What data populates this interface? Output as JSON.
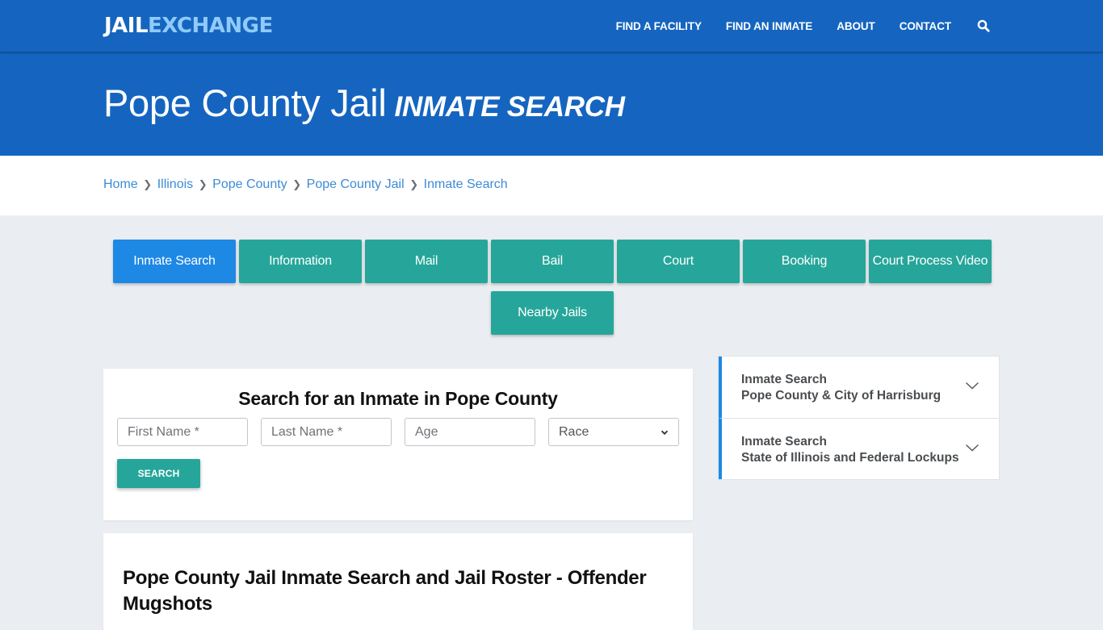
{
  "brand": {
    "logo_part1": "JAIL",
    "logo_part2": "EXCHANGE",
    "primary_color": "#1565c0",
    "accent_color": "#26a69a",
    "active_color": "#1e88e5"
  },
  "nav": {
    "items": [
      {
        "label": "FIND A FACILITY"
      },
      {
        "label": "FIND AN INMATE"
      },
      {
        "label": "ABOUT"
      },
      {
        "label": "CONTACT"
      }
    ],
    "search_icon": "search-icon"
  },
  "hero": {
    "title": "Pope County Jail",
    "subtitle": "INMATE SEARCH"
  },
  "breadcrumb": [
    {
      "label": "Home"
    },
    {
      "label": "Illinois"
    },
    {
      "label": "Pope County"
    },
    {
      "label": "Pope County Jail"
    },
    {
      "label": "Inmate Search"
    }
  ],
  "tabs": [
    {
      "label": "Inmate Search",
      "active": true
    },
    {
      "label": "Information",
      "active": false
    },
    {
      "label": "Mail",
      "active": false
    },
    {
      "label": "Bail",
      "active": false
    },
    {
      "label": "Court",
      "active": false
    },
    {
      "label": "Booking",
      "active": false
    },
    {
      "label": "Court Process Video",
      "active": false
    },
    {
      "label": "Nearby Jails",
      "active": false
    }
  ],
  "search_form": {
    "title": "Search for an Inmate in Pope County",
    "first_name": {
      "value": "",
      "placeholder": "First Name *"
    },
    "last_name": {
      "value": "",
      "placeholder": "Last Name *"
    },
    "age": {
      "value": "",
      "placeholder": "Age"
    },
    "race": {
      "selected": "Race"
    },
    "submit_label": "SEARCH"
  },
  "article": {
    "title": "Pope County Jail Inmate Search and Jail Roster - Offender Mugshots"
  },
  "sidebar": {
    "items": [
      {
        "line1": "Inmate Search",
        "line2": "Pope County & City of Harrisburg"
      },
      {
        "line1": "Inmate Search",
        "line2": "State of Illinois and Federal Lockups"
      }
    ]
  }
}
